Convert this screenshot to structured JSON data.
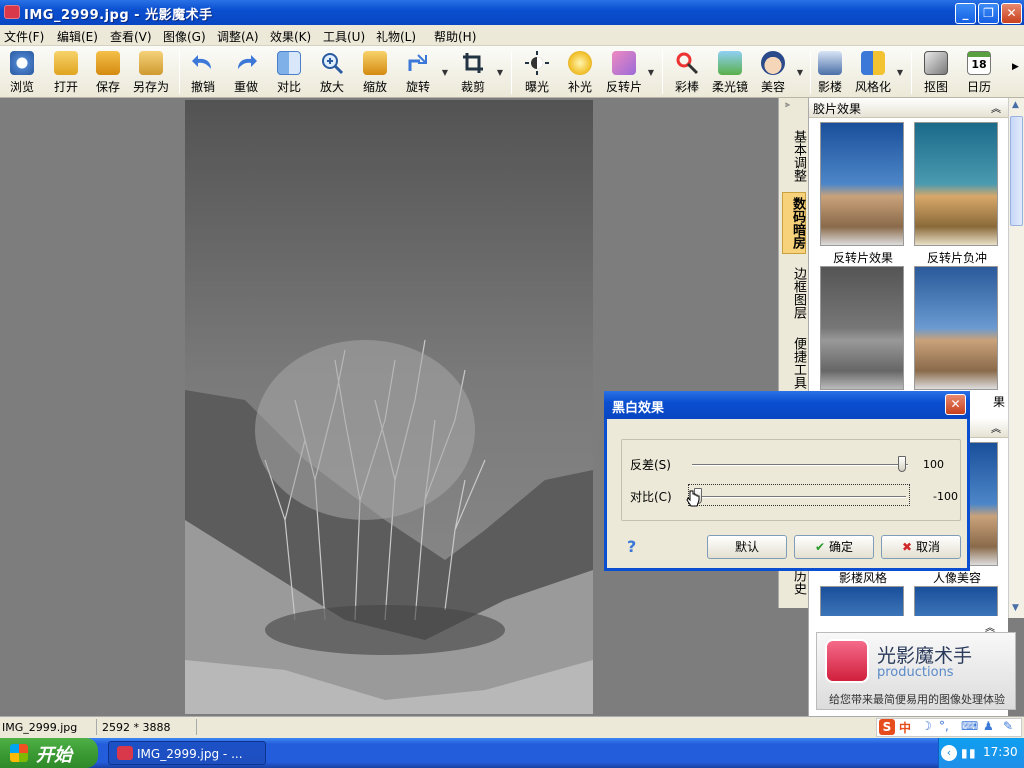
{
  "window": {
    "title": "IMG_2999.jpg - 光影魔术手"
  },
  "menubar": [
    "文件(F)",
    "编辑(E)",
    "查看(V)",
    "图像(G)",
    "调整(A)",
    "效果(K)",
    "工具(U)",
    "礼物(L)",
    "帮助(H)"
  ],
  "toolbar": [
    {
      "label": "浏览",
      "icon": "browse-icon"
    },
    {
      "label": "打开",
      "icon": "folder-open-icon"
    },
    {
      "label": "保存",
      "icon": "save-icon"
    },
    {
      "label": "另存为",
      "icon": "save-as-icon"
    },
    {
      "label": "撤销",
      "icon": "undo-icon"
    },
    {
      "label": "重做",
      "icon": "redo-icon"
    },
    {
      "label": "对比",
      "icon": "compare-icon"
    },
    {
      "label": "放大",
      "icon": "zoom-in-icon"
    },
    {
      "label": "缩放",
      "icon": "resize-icon"
    },
    {
      "label": "旋转",
      "icon": "rotate-icon"
    },
    {
      "label": "裁剪",
      "icon": "crop-icon"
    },
    {
      "label": "曝光",
      "icon": "exposure-icon"
    },
    {
      "label": "补光",
      "icon": "fill-light-icon"
    },
    {
      "label": "反转片",
      "icon": "reversal-film-icon"
    },
    {
      "label": "彩棒",
      "icon": "color-wand-icon"
    },
    {
      "label": "柔光镜",
      "icon": "soft-light-icon"
    },
    {
      "label": "美容",
      "icon": "beauty-icon"
    },
    {
      "label": "影楼",
      "icon": "studio-icon"
    },
    {
      "label": "风格化",
      "icon": "stylize-icon"
    },
    {
      "label": "抠图",
      "icon": "cutout-icon"
    },
    {
      "label": "日历",
      "icon": "calendar-icon"
    }
  ],
  "calendar_day": "18",
  "sidetabs": [
    {
      "label": "基本调整",
      "active": false
    },
    {
      "label": "数码暗房",
      "active": true
    },
    {
      "label": "边框图层",
      "active": false
    },
    {
      "label": "便捷工具",
      "active": false
    }
  ],
  "sidetab_bottom": "历史",
  "panel": {
    "section1_title": "胶片效果",
    "thumbs": [
      {
        "label": "反转片效果"
      },
      {
        "label": "反转片负冲"
      },
      {
        "label": ""
      },
      {
        "label": "果"
      },
      {
        "label": "影楼风格"
      },
      {
        "label": "人像美容"
      }
    ]
  },
  "promo": {
    "brand": "光影魔术手",
    "sub": "productions",
    "slogan": "给您带来最简便易用的图像处理体验"
  },
  "status": {
    "filename": "IMG_2999.jpg",
    "dimensions": "2592 * 3888"
  },
  "taskbar": {
    "start_label": "开始",
    "task_label": "IMG_2999.jpg - ...",
    "time": "17:30",
    "ime": "中"
  },
  "dialog": {
    "title": "黑白效果",
    "sliders": [
      {
        "label": "反差(S)",
        "value": "100",
        "position": 1.0
      },
      {
        "label": "对比(C)",
        "value": "-100",
        "position": 0.0
      }
    ],
    "buttons": {
      "default": "默认",
      "ok": "确定",
      "cancel": "取消"
    },
    "help": "?"
  }
}
